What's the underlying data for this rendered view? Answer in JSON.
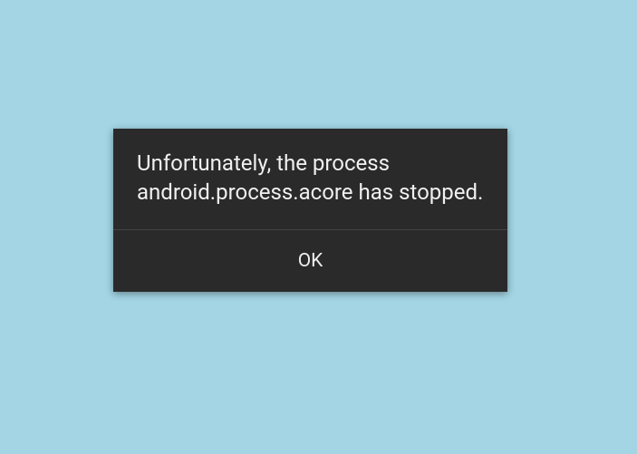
{
  "dialog": {
    "message": "Unfortunately, the process android.process.acore has stopped.",
    "ok_label": "OK"
  }
}
